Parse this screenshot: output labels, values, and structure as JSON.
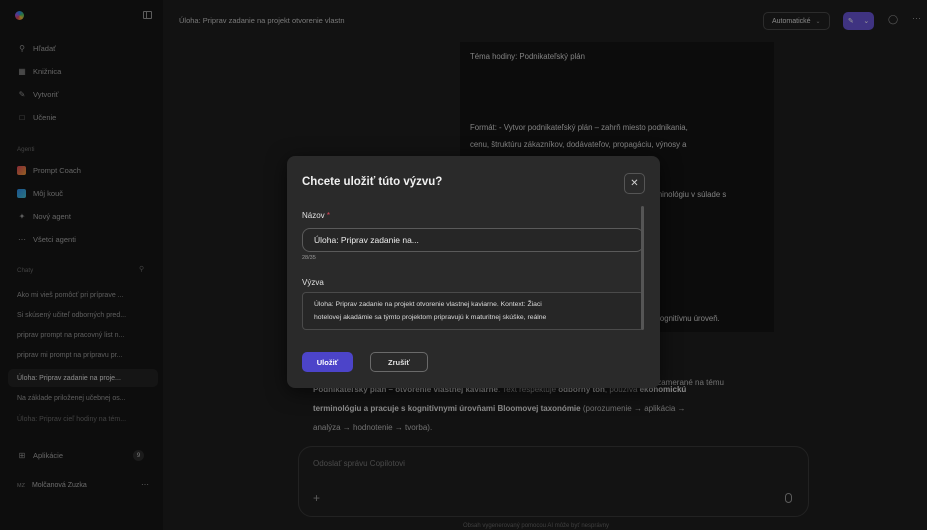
{
  "sidebar": {
    "nav": [
      {
        "label": "Hľadať",
        "icon": "search-icon"
      },
      {
        "label": "Knižnica",
        "icon": "library-icon"
      },
      {
        "label": "Vytvoriť",
        "icon": "create-icon"
      },
      {
        "label": "Učenie",
        "icon": "learn-icon"
      }
    ],
    "agents_label": "Agenti",
    "agents": [
      {
        "label": "Prompt Coach",
        "icon": "prompt-coach-icon"
      },
      {
        "label": "Môj kouč",
        "icon": "coach-icon"
      },
      {
        "label": "Nový agent",
        "icon": "new-agent-icon"
      },
      {
        "label": "Všetci agenti",
        "icon": "all-agents-icon"
      }
    ],
    "chats_label": "Chaty",
    "chats": [
      "Ako mi vieš pomôcť pri príprave ...",
      "Si skúsený učiteľ odborných pred...",
      "priprav prompt na pracovný list n...",
      "priprav mi prompt na prípravu pr...",
      "Úloha: Priprav zadanie na proje...",
      "Na základe priloženej učebnej os...",
      "Úloha: Priprav cieľ hodiny na tém..."
    ],
    "apps_label": "Aplikácie",
    "apps_badge": "9",
    "user": {
      "initials": "MZ",
      "name": "Molčanová Zuzka"
    }
  },
  "header": {
    "title": "Úloha: Priprav zadanie na projekt otvorenie vlastn",
    "mode_label": "Automatické"
  },
  "prompt_card": {
    "line1": "Téma hodiny: Podnikateľský plán",
    "line2": "Formát: - Vytvor podnikateľský plán – zahrň miesto podnikania,",
    "line3": "cenu, štruktúru zákazníkov, dodávateľov, propagáciu, výnosy a",
    "line4_tail": "rminológiu v súlade s",
    "line5_tail": "kognitívnu úroveň."
  },
  "reply": {
    "top_tail": "démie, zamerané na tému",
    "line1_bold": "Podnikateľský plán – otvorenie vlastnej kaviarne",
    "line1_rest": ". Text rešpektuje ",
    "line1_bold2": "odborný tón",
    "line1_rest2": ", používa ",
    "line1_bold3": "ekonomickú",
    "line2_bold": "terminológiu a pracuje s kognitívnymi úrovňami Bloomovej taxonómie",
    "line2_rest": " (porozumenie → aplikácia →",
    "line3": "analýza → hodnotenie → tvorba)."
  },
  "composer": {
    "placeholder": "Odoslať správu Copilotovi",
    "disclaimer": "Obsah vygenerovaný pomocou AI môže byť nesprávny"
  },
  "modal": {
    "title": "Chcete uložiť túto výzvu?",
    "name_label": "Názov",
    "name_required": "*",
    "name_value": "Úloha: Priprav zadanie na...",
    "counter": "28/35",
    "prompt_label": "Výzva",
    "prompt_line1": "Úloha: Priprav zadanie na projekt otvorenie vlastnej kaviarne. Kontext: Žiaci",
    "prompt_line2": "hotelovej akadámie sa týmto projektom pripravujú k maturitnej skúške, reálne",
    "save_label": "Uložiť",
    "cancel_label": "Zrušiť"
  }
}
